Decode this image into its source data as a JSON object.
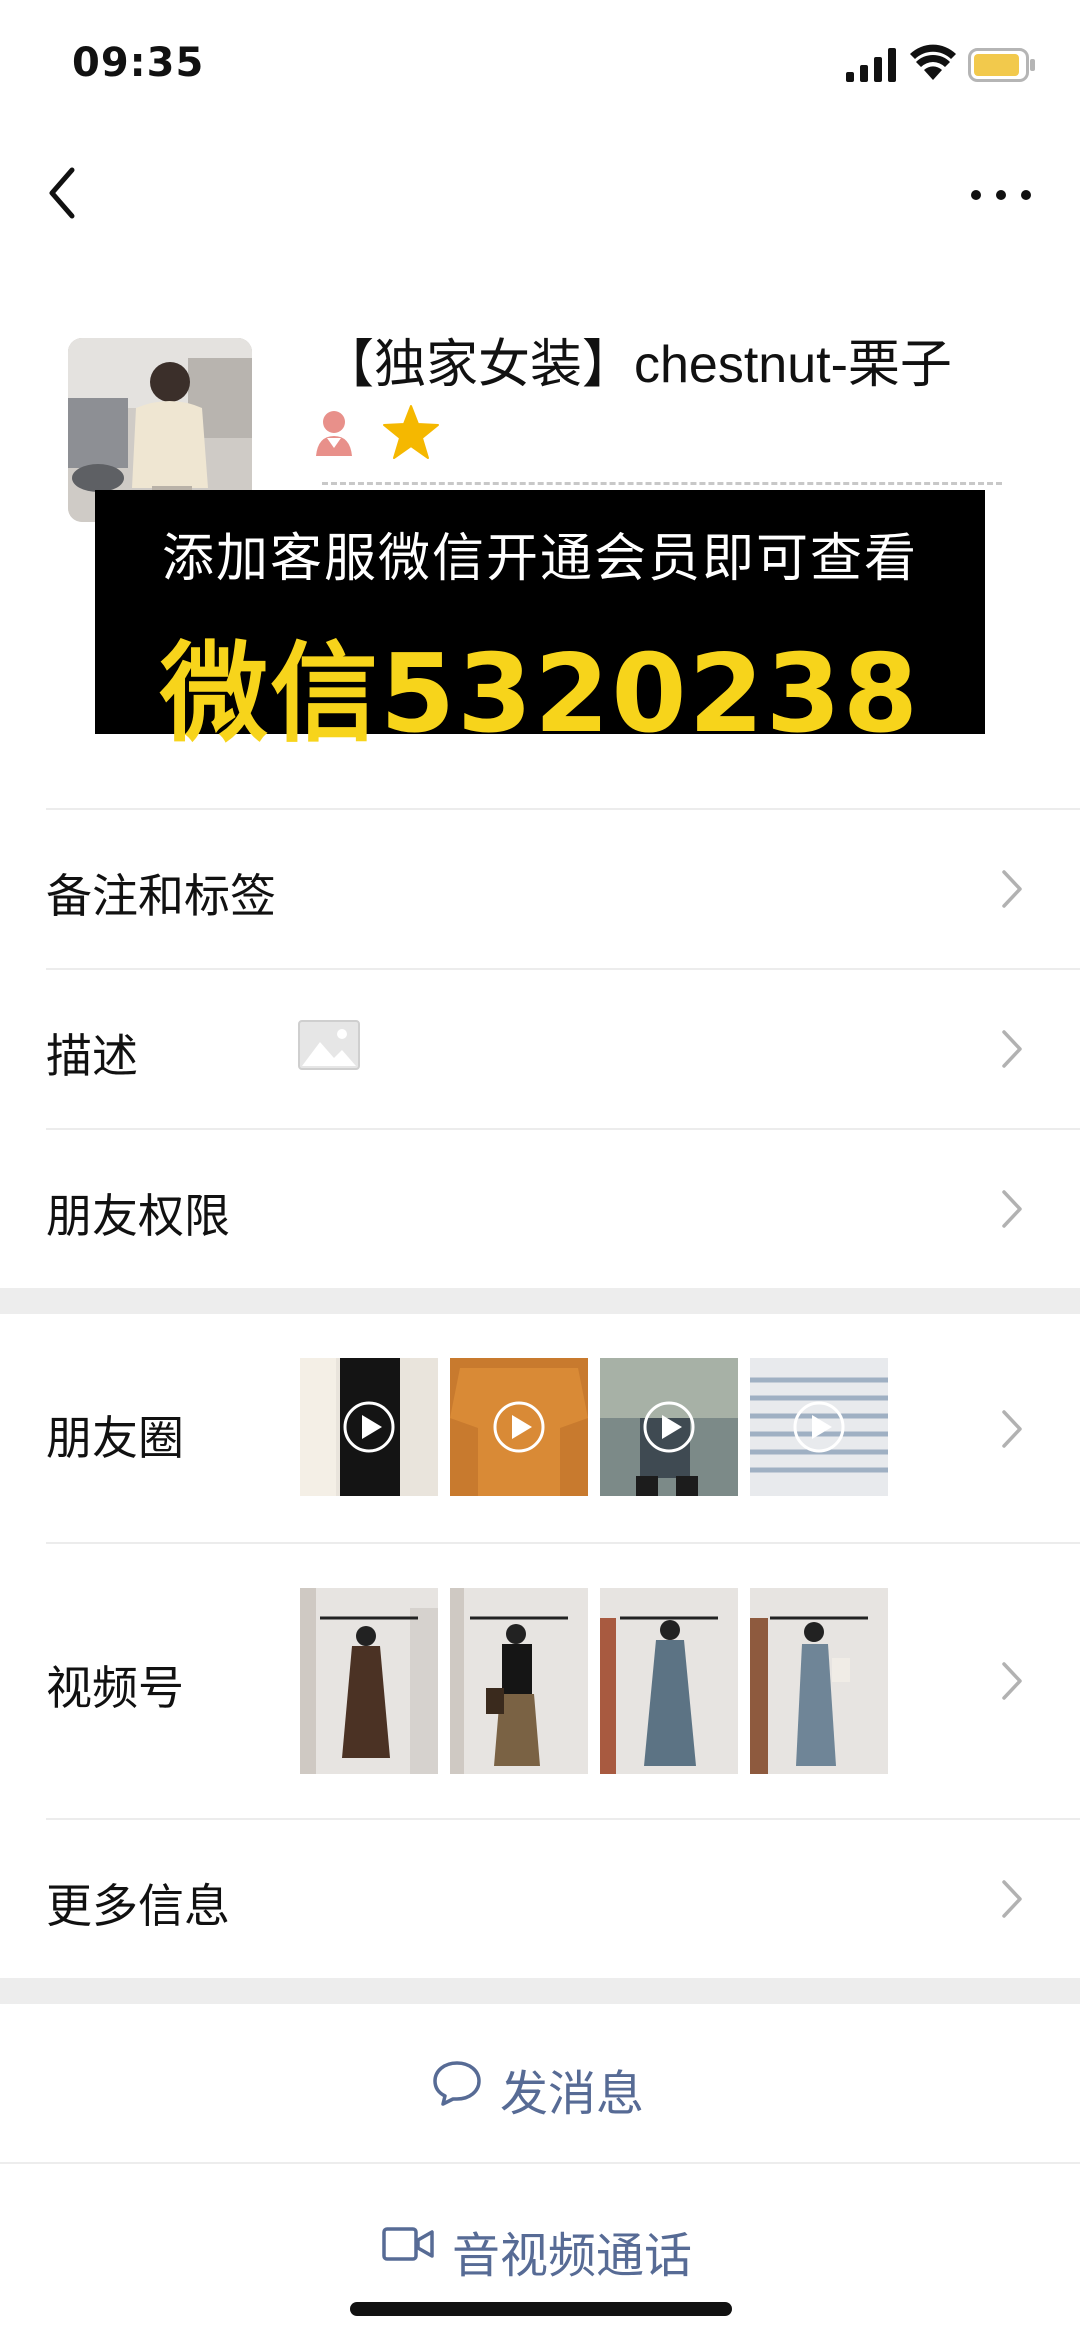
{
  "status_bar": {
    "time": "09:35",
    "battery_color": "#f2c94c"
  },
  "nav": {
    "back_icon": "chevron-left-icon",
    "more_icon": "ellipsis-icon"
  },
  "profile": {
    "nickname": "【独家女装】chestnut-栗子",
    "gender_icon": "female-person-icon",
    "star_icon": "star-icon",
    "star_color": "#f5b800"
  },
  "promo": {
    "line1": "添加客服微信开通会员即可查看",
    "line2": "微信5320238",
    "accent_color": "#f7d41b"
  },
  "rows": {
    "remarks_label": "备注和标签",
    "description_label": "描述",
    "friend_permissions_label": "朋友权限",
    "moments_label": "朋友圈",
    "channels_label": "视频号",
    "more_info_label": "更多信息"
  },
  "actions": {
    "send_message_label": "发消息",
    "av_call_label": "音视频通话",
    "link_color": "#576b95"
  }
}
